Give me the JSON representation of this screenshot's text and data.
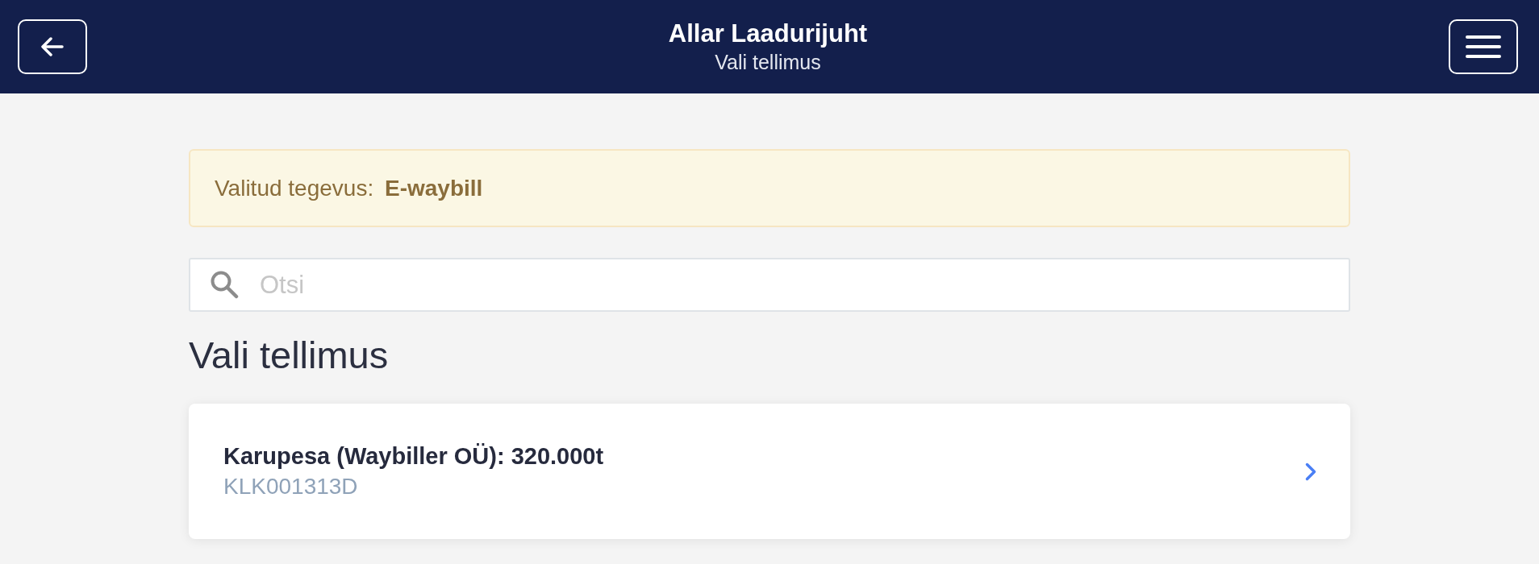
{
  "header": {
    "title": "Allar Laadurijuht",
    "subtitle": "Vali tellimus"
  },
  "notice": {
    "text": "Valitud tegevus: **E-waybill**"
  },
  "search": {
    "placeholder": "Otsi"
  },
  "heading": "Vali tellimus",
  "orders": [
    {
      "title": "Karupesa (Waybiller OÜ): 320.000t",
      "code": "KLK001313D"
    }
  ]
}
